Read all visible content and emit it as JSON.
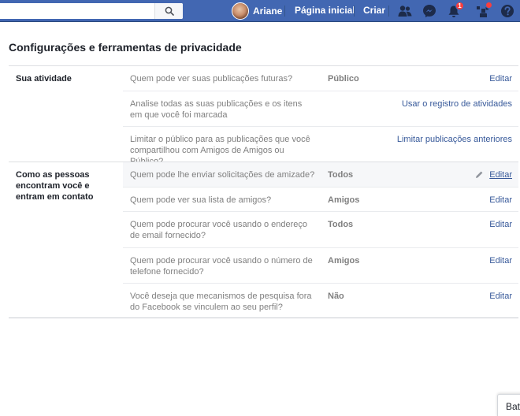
{
  "header": {
    "search_placeholder": "",
    "user_name": "Ariane",
    "home_label": "Página inicial",
    "create_label": "Criar",
    "notifications_count": "1",
    "brand_color": "#4267b2"
  },
  "page": {
    "title": "Configurações e ferramentas de privacidade"
  },
  "sections": [
    {
      "title": "Sua atividade",
      "rows": [
        {
          "question": "Quem pode ver suas publicações futuras?",
          "value": "Público",
          "action": "Editar"
        },
        {
          "question": "Analise todas as suas publicações e os itens em que você foi marcada",
          "value": "",
          "action": "Usar o registro de atividades"
        },
        {
          "question": "Limitar o público para as publicações que você compartilhou com Amigos de Amigos ou Público?",
          "value": "",
          "action": "Limitar publicações anteriores"
        }
      ]
    },
    {
      "title": "Como as pessoas encontram você e entram em contato",
      "rows": [
        {
          "question": "Quem pode lhe enviar solicitações de amizade?",
          "value": "Todos",
          "action": "Editar"
        },
        {
          "question": "Quem pode ver sua lista de amigos?",
          "value": "Amigos",
          "action": "Editar"
        },
        {
          "question": "Quem pode procurar você usando o endereço de email fornecido?",
          "value": "Todos",
          "action": "Editar"
        },
        {
          "question": "Quem pode procurar você usando o número de telefone fornecido?",
          "value": "Amigos",
          "action": "Editar"
        },
        {
          "question": "Você deseja que mecanismos de pesquisa fora do Facebook se vinculem ao seu perfil?",
          "value": "Não",
          "action": "Editar"
        }
      ]
    }
  ],
  "chat": {
    "label": "Bat"
  }
}
